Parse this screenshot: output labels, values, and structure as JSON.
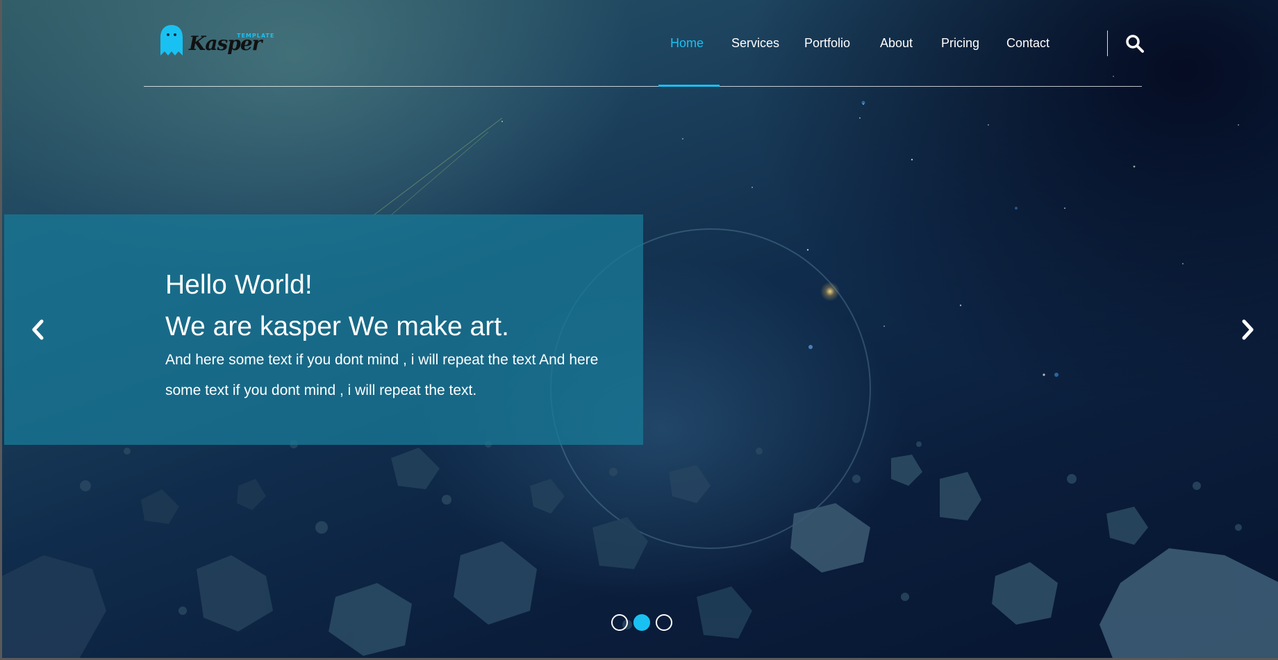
{
  "brand": {
    "name": "Kasper",
    "tagline": "TEMPLATE",
    "accent_color": "#19c1f2"
  },
  "nav": {
    "items": [
      {
        "label": "Home",
        "active": true
      },
      {
        "label": "Services",
        "active": false
      },
      {
        "label": "Portfolio",
        "active": false
      },
      {
        "label": "About",
        "active": false
      },
      {
        "label": "Pricing",
        "active": false
      },
      {
        "label": "Contact",
        "active": false
      }
    ],
    "search_icon": "search-icon"
  },
  "slide": {
    "heading_line1": "Hello World!",
    "heading_line2": "We are kasper We make art.",
    "text": "And here some text if you dont mind , i will repeat the text And here some text if you dont mind , i will repeat the text."
  },
  "carousel": {
    "prev_icon": "chevron-left-icon",
    "next_icon": "chevron-right-icon",
    "slide_count": 3,
    "active_index": 1
  }
}
